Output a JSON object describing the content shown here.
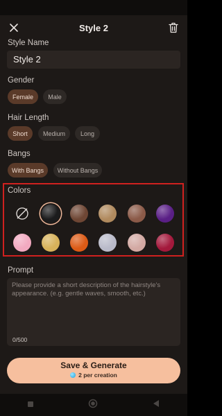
{
  "header": {
    "title": "Style 2"
  },
  "style_name": {
    "label": "Style Name",
    "value": "Style 2"
  },
  "gender": {
    "label": "Gender",
    "options": [
      "Female",
      "Male"
    ],
    "selected": "Female"
  },
  "hair_length": {
    "label": "Hair Length",
    "options": [
      "Short",
      "Medium",
      "Long"
    ],
    "selected": "Short"
  },
  "bangs": {
    "label": "Bangs",
    "options": [
      "With Bangs",
      "Without Bangs"
    ],
    "selected": "With Bangs"
  },
  "colors": {
    "label": "Colors",
    "selected_index": 1,
    "swatches": [
      {
        "name": "none",
        "color": ""
      },
      {
        "name": "black",
        "color": "#1b1b1c"
      },
      {
        "name": "brown",
        "color": "#6e4634"
      },
      {
        "name": "light-brown",
        "color": "#b08a5e"
      },
      {
        "name": "auburn-brown",
        "color": "#8b5a48"
      },
      {
        "name": "purple",
        "color": "#5a1f86"
      },
      {
        "name": "pink",
        "color": "#f2a9c0"
      },
      {
        "name": "golden-blonde",
        "color": "#d7b25a"
      },
      {
        "name": "orange",
        "color": "#dc5b16"
      },
      {
        "name": "silver",
        "color": "#b9bac9"
      },
      {
        "name": "rose-beige",
        "color": "#d3a9a3"
      },
      {
        "name": "crimson",
        "color": "#a3193c"
      }
    ]
  },
  "prompt": {
    "label": "Prompt",
    "placeholder": "Please provide a short description of the hairstyle's appearance. (e.g. gentle waves, smooth, etc.)",
    "counter": "0/500"
  },
  "cta": {
    "label": "Save & Generate",
    "cost": "2 per creation"
  }
}
